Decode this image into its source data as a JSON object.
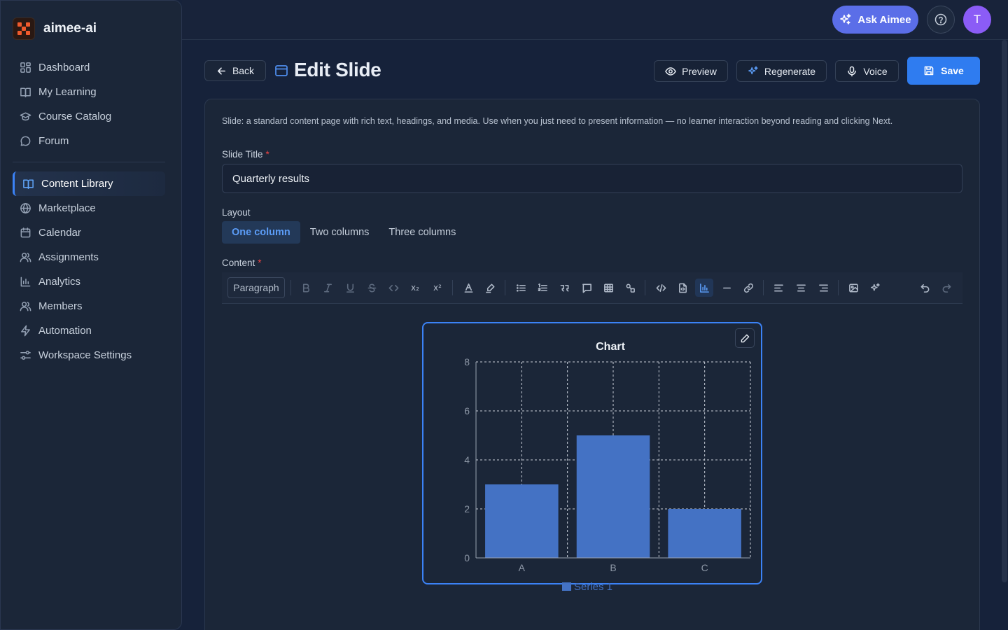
{
  "brand": {
    "name": "aimee-ai"
  },
  "sidebar": {
    "items": [
      {
        "label": "Dashboard",
        "icon": "dashboard-icon"
      },
      {
        "label": "My Learning",
        "icon": "book-icon"
      },
      {
        "label": "Course Catalog",
        "icon": "graduation-cap-icon"
      },
      {
        "label": "Forum",
        "icon": "chat-bubble-icon"
      }
    ],
    "items2": [
      {
        "label": "Content Library",
        "icon": "book-open-icon",
        "active": true
      },
      {
        "label": "Marketplace",
        "icon": "globe-icon"
      },
      {
        "label": "Calendar",
        "icon": "calendar-icon"
      },
      {
        "label": "Assignments",
        "icon": "users-icon"
      },
      {
        "label": "Analytics",
        "icon": "bar-chart-icon"
      },
      {
        "label": "Members",
        "icon": "users-icon"
      },
      {
        "label": "Automation",
        "icon": "lightning-icon"
      },
      {
        "label": "Workspace Settings",
        "icon": "sliders-icon"
      }
    ]
  },
  "topbar": {
    "ask_label": "Ask Aimee",
    "avatar_initial": "T"
  },
  "header": {
    "back_label": "Back",
    "title": "Edit Slide",
    "preview_label": "Preview",
    "regenerate_label": "Regenerate",
    "voice_label": "Voice",
    "save_label": "Save"
  },
  "form": {
    "description": "Slide: a standard content page with rich text, headings, and media. Use when you just need to present information — no learner interaction beyond reading and clicking Next.",
    "title_label": "Slide Title",
    "required_mark": "*",
    "title_value": "Quarterly results",
    "layout_label": "Layout",
    "layout_options": [
      "One column",
      "Two columns",
      "Three columns"
    ],
    "layout_selected": "One column",
    "content_label": "Content",
    "paragraph_select": "Paragraph"
  },
  "colors": {
    "accent": "#3b82f6",
    "bar": "#4472c4",
    "danger": "#ef4444",
    "avatar": "#8b5cf6"
  },
  "chart_data": {
    "type": "bar",
    "title": "Chart",
    "categories": [
      "A",
      "B",
      "C"
    ],
    "series": [
      {
        "name": "Series 1",
        "values": [
          3,
          5,
          2
        ]
      }
    ],
    "ylim": [
      0,
      8
    ],
    "yticks": [
      0,
      2,
      4,
      6,
      8
    ],
    "grid": true,
    "legend": "bottom"
  }
}
